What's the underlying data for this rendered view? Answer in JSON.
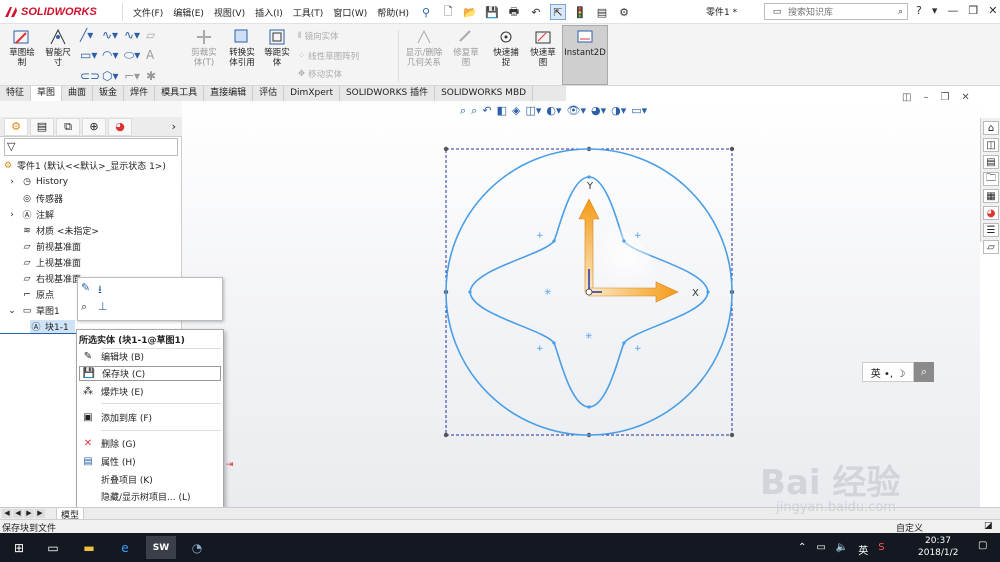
{
  "app": {
    "logo_text": "SOLIDWORKS",
    "part_name": "零件1 *",
    "search_placeholder": "搜索知识库"
  },
  "menu": [
    "文件(F)",
    "编辑(E)",
    "视图(V)",
    "插入(I)",
    "工具(T)",
    "窗口(W)",
    "帮助(H)"
  ],
  "commands": {
    "sketch": "草图绘制",
    "smart_dim": "智能尺寸",
    "trim": "剪裁实体(T)",
    "convert": "转换实体引用",
    "offset": "等距实体",
    "mirror": "镜向实体",
    "linear_pattern": "线性草图阵列",
    "move": "移动实体",
    "display_relations": "显示/删除几何关系",
    "repair": "修复草图",
    "quick_snap": "快速捕捉",
    "rapid_sketch": "快速草图",
    "instant2d": "Instant2D"
  },
  "tabs": [
    {
      "label": "特征",
      "active": false
    },
    {
      "label": "草图",
      "active": true
    },
    {
      "label": "曲面",
      "active": false
    },
    {
      "label": "钣金",
      "active": false
    },
    {
      "label": "焊件",
      "active": false
    },
    {
      "label": "模具工具",
      "active": false
    },
    {
      "label": "直接编辑",
      "active": false
    },
    {
      "label": "评估",
      "active": false
    },
    {
      "label": "DimXpert",
      "active": false
    },
    {
      "label": "SOLIDWORKS 插件",
      "active": false
    },
    {
      "label": "SOLIDWORKS MBD",
      "active": false
    }
  ],
  "tree": {
    "root": "零件1 (默认<<默认>_显示状态 1>)",
    "items": [
      {
        "label": "History",
        "icon": "history-icon"
      },
      {
        "label": "传感器",
        "icon": "sensor-icon"
      },
      {
        "label": "注解",
        "icon": "annotation-icon"
      },
      {
        "label": "材质 <未指定>",
        "icon": "material-icon"
      },
      {
        "label": "前视基准面",
        "icon": "plane-icon"
      },
      {
        "label": "上视基准面",
        "icon": "plane-icon"
      },
      {
        "label": "右视基准面",
        "icon": "plane-icon"
      },
      {
        "label": "原点",
        "icon": "origin-icon"
      },
      {
        "label": "草图1",
        "icon": "sketch-icon"
      },
      {
        "label": "块1-1",
        "icon": "block-icon"
      }
    ],
    "bottom_tab": "模型"
  },
  "context_menu": {
    "header": "所选实体 (块1-1@草图1)",
    "items": [
      {
        "label": "编辑块 (B)",
        "icon": "edit-block-icon"
      },
      {
        "label": "保存块 (C)",
        "icon": "save-block-icon",
        "highlighted": true
      },
      {
        "label": "爆炸块 (E)",
        "icon": "explode-block-icon"
      },
      {
        "label": "添加到库 (F)",
        "icon": "add-to-library-icon"
      },
      {
        "label": "删除 (G)",
        "icon": "delete-icon"
      },
      {
        "label": "属性 (H)",
        "icon": "properties-icon"
      },
      {
        "label": "折叠项目 (K)",
        "icon": ""
      },
      {
        "label": "隐藏/显示树项目... (L)",
        "icon": ""
      }
    ],
    "more": "»"
  },
  "viewport": {
    "axis_x": "X",
    "axis_y": "Y",
    "ime_text": "英 •, ☽"
  },
  "status": {
    "text": "保存块到文件",
    "right_text": "自定义"
  },
  "taskbar": {
    "time": "20:37",
    "date": "2018/1/2",
    "ime": "英"
  },
  "watermark": {
    "line1": "Bai 经验",
    "line2": "jingyan.baidu.com"
  }
}
